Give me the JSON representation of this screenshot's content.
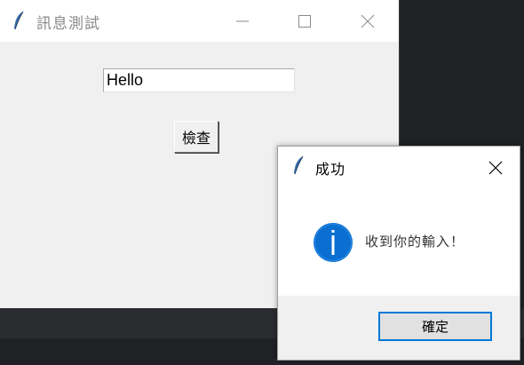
{
  "main_window": {
    "title": "訊息測試",
    "entry_value": "Hello",
    "check_button_label": "檢查"
  },
  "message_box": {
    "title": "成功",
    "message": "收到你的輸入！",
    "ok_button_label": "確定"
  },
  "icons": {
    "app": "feather-icon",
    "minimize": "minimize-icon",
    "maximize": "maximize-icon",
    "close": "close-icon",
    "info": "info-icon"
  },
  "colors": {
    "info_icon_fill": "#0a6fd0",
    "ok_button_border": "#0078d7"
  }
}
